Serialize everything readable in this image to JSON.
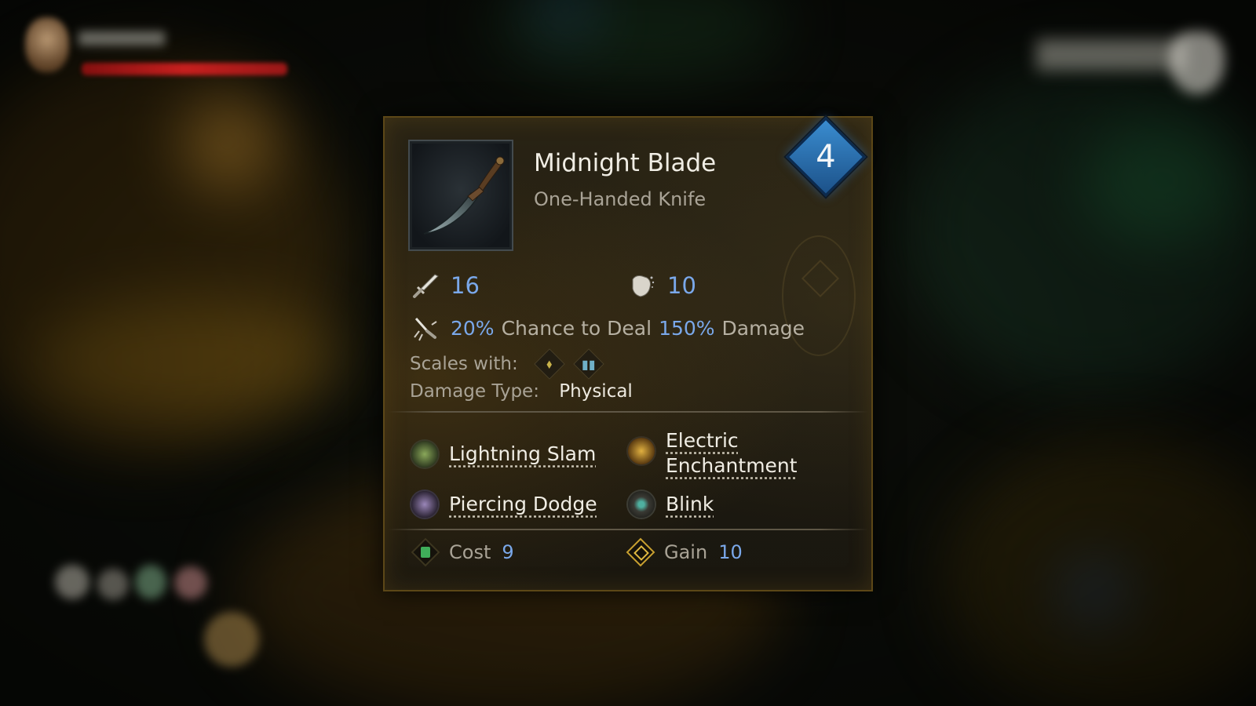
{
  "item": {
    "name": "Midnight Blade",
    "type": "One-Handed Knife",
    "level": "4",
    "image": "knife-icon"
  },
  "stats": {
    "attack": {
      "icon": "sword-icon",
      "value": "16"
    },
    "stamina": {
      "icon": "fist-icon",
      "value": "10"
    }
  },
  "effect": {
    "icon": "critical-strike-icon",
    "chance": "20%",
    "text1": "Chance to Deal",
    "multiplier": "150%",
    "text2": "Damage"
  },
  "scales": {
    "label": "Scales with:",
    "icons": [
      "agility-rune-icon",
      "spellbook-icon"
    ]
  },
  "damage_type": {
    "label": "Damage Type:",
    "value": "Physical"
  },
  "skills": [
    {
      "label": "Lightning Slam",
      "icon": "lightning-slam-icon"
    },
    {
      "label": "Electric Enchantment",
      "icon": "electric-enchantment-icon"
    },
    {
      "label": "Piercing Dodge",
      "icon": "piercing-dodge-icon"
    },
    {
      "label": "Blink",
      "icon": "blink-icon"
    }
  ],
  "footer": {
    "cost": {
      "label": "Cost",
      "value": "9",
      "icon": "cost-icon"
    },
    "gain": {
      "label": "Gain",
      "value": "10",
      "icon": "gain-icon"
    }
  },
  "colors": {
    "accent_blue": "#7aa8ea",
    "level_badge": "#2f78c0",
    "panel_border": "#5c4717"
  }
}
